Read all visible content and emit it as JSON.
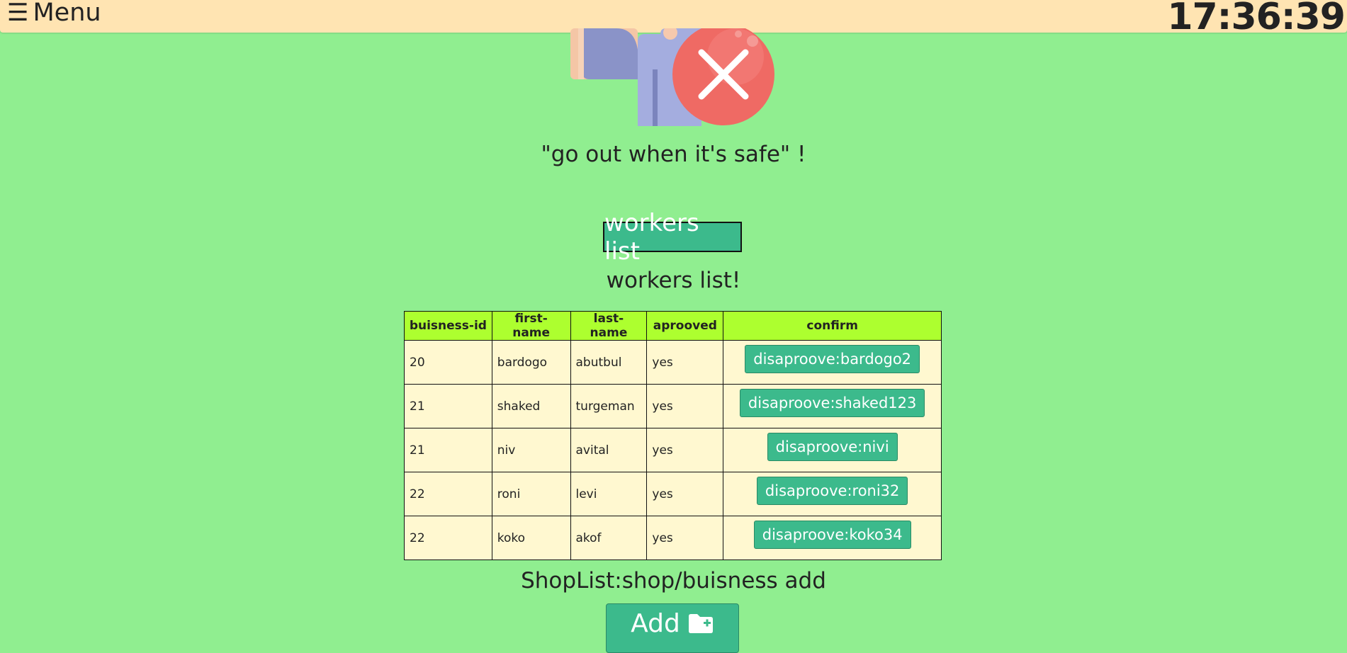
{
  "header": {
    "menu_icon": "☰",
    "menu_label": "Menu",
    "clock": "17:36:39"
  },
  "illustration": {
    "icon": "close-icon"
  },
  "quote": "\"go out when it's safe\" !",
  "workers_button": "workers list",
  "workers_title": "workers list!",
  "table": {
    "columns": [
      "buisness-id",
      "first-name",
      "last-name",
      "aprooved",
      "confirm"
    ],
    "rows": [
      {
        "business_id": "20",
        "first_name": "bardogo",
        "last_name": "abutbul",
        "approved": "yes",
        "action": "disaproove:bardogo2"
      },
      {
        "business_id": "21",
        "first_name": "shaked",
        "last_name": "turgeman",
        "approved": "yes",
        "action": "disaproove:shaked123"
      },
      {
        "business_id": "21",
        "first_name": "niv",
        "last_name": "avital",
        "approved": "yes",
        "action": "disaproove:nivi"
      },
      {
        "business_id": "22",
        "first_name": "roni",
        "last_name": "levi",
        "approved": "yes",
        "action": "disaproove:roni32"
      },
      {
        "business_id": "22",
        "first_name": "koko",
        "last_name": "akof",
        "approved": "yes",
        "action": "disaproove:koko34"
      }
    ]
  },
  "shoplist_title": "ShopList:shop/buisness add",
  "add_button": {
    "label": "Add",
    "icon": "folder-plus-icon"
  },
  "colors": {
    "page_background": "#90ee90",
    "header_background": "#ffe4b2",
    "button": "#3cba8c",
    "table_header": "#adff2f",
    "table_cell": "#fff8d0"
  }
}
